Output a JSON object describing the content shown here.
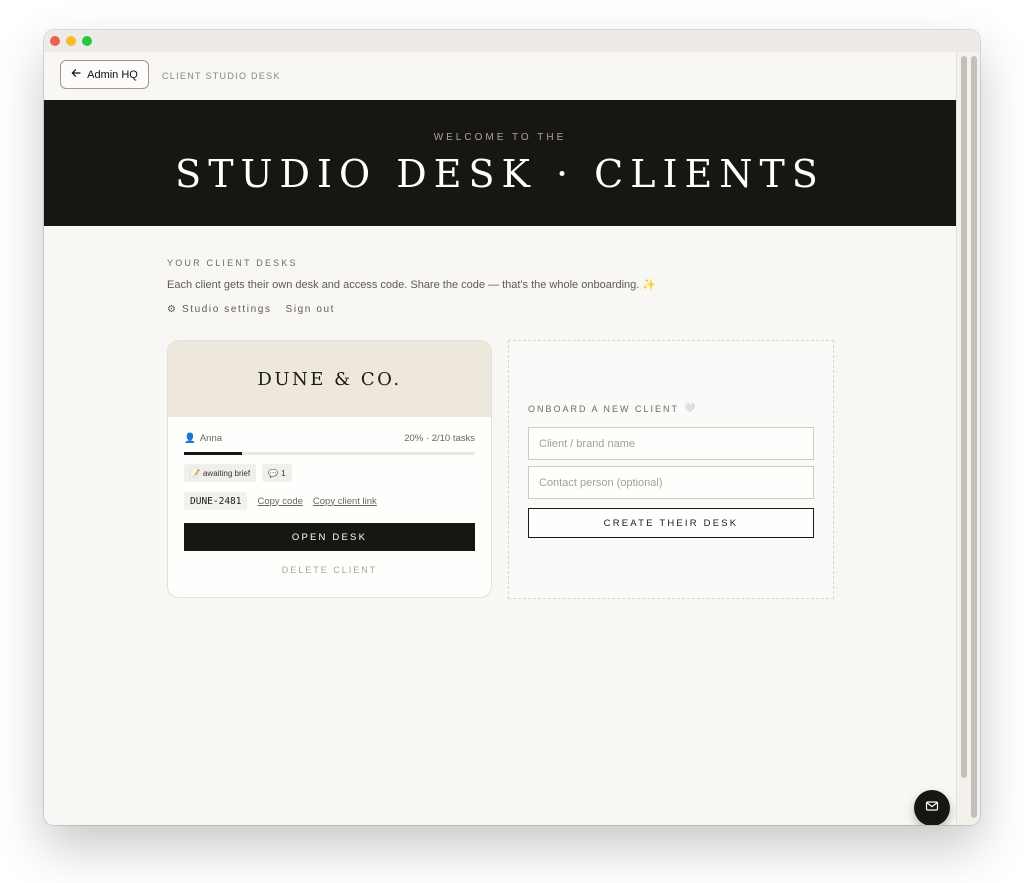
{
  "topbar": {
    "back_label": "Admin HQ",
    "section_label": "CLIENT STUDIO DESK"
  },
  "hero": {
    "kicker": "WELCOME TO THE",
    "title": "STUDIO DESK · CLIENTS"
  },
  "intro": {
    "kicker": "YOUR CLIENT DESKS",
    "description": "Each client gets their own desk and access code. Share the code — that's the whole onboarding. ✨",
    "settings_link": "⚙ Studio settings",
    "signout_link": "Sign out"
  },
  "client_card": {
    "name": "DUNE & CO.",
    "contact": "Anna",
    "contact_icon": "👤",
    "progress_text": "20% · 2/10 tasks",
    "progress_fraction": 0.2,
    "status_tag_icon": "📝",
    "status_tag": "awaiting brief",
    "comments_icon": "💬",
    "comments_count": "1",
    "access_code": "DUNE-2481",
    "copy_code": "Copy code",
    "copy_link": "Copy client link",
    "open_label": "OPEN DESK",
    "delete_label": "DELETE CLIENT"
  },
  "new_client": {
    "kicker": "ONBOARD A NEW CLIENT",
    "kicker_icon": "🤍",
    "brand_placeholder": "Client / brand name",
    "contact_placeholder": "Contact person (optional)",
    "create_label": "CREATE THEIR DESK"
  },
  "colors": {
    "ink": "#171613",
    "paper": "#f8f7f3",
    "card_head": "#ede7dc"
  },
  "icons": {
    "back": "arrow-left-icon",
    "fab": "mail-icon"
  }
}
